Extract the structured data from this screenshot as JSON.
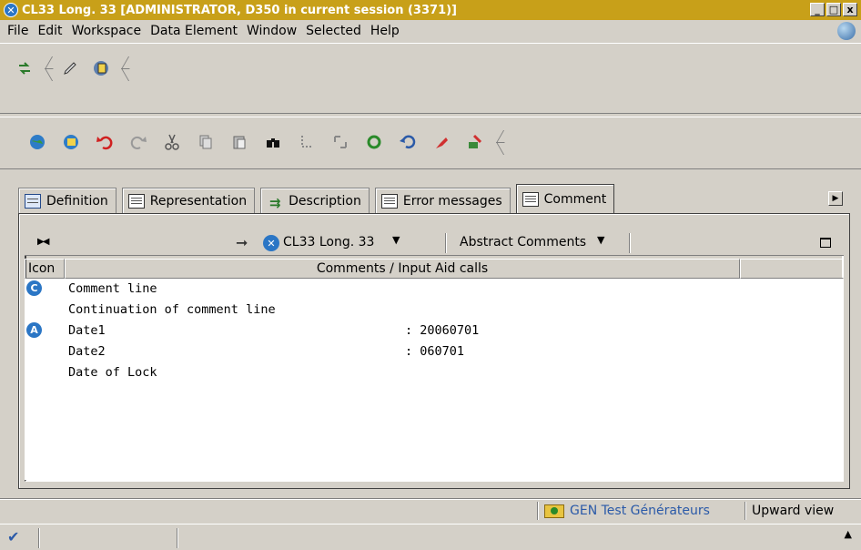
{
  "window": {
    "title": "CL33 Long. 33 [ADMINISTRATOR, D350 in current session (3371)]",
    "minimize": "_",
    "maximize": "□",
    "close": "x"
  },
  "menu": [
    "File",
    "Edit",
    "Workspace",
    "Data Element",
    "Window",
    "Selected",
    "Help"
  ],
  "toolbar1": {
    "icons": [
      "swap-icon",
      "pen-icon",
      "info-book-icon"
    ]
  },
  "toolbar2": {
    "icons": [
      "globe-icon",
      "list-icon",
      "undo-icon",
      "redo-icon",
      "cut-icon",
      "copy-icon",
      "paste-icon",
      "find-icon",
      "select-icon",
      "expand-icon",
      "refresh-icon",
      "back-icon",
      "pin-icon",
      "tools-icon"
    ]
  },
  "tabs": [
    {
      "label": "Definition",
      "icon": "edit-icon"
    },
    {
      "label": "Representation",
      "icon": "form-icon"
    },
    {
      "label": "Description",
      "icon": "description-icon"
    },
    {
      "label": "Error messages",
      "icon": "form-icon"
    },
    {
      "label": "Comment",
      "icon": "form-icon",
      "active": true
    }
  ],
  "panel": {
    "object_name": "CL33 Long. 33",
    "view_name": "Abstract Comments"
  },
  "columns": {
    "icon": "Icon",
    "comments": "Comments / Input Aid calls"
  },
  "rows": [
    {
      "badge": "C",
      "text": "Comment line",
      "value": ""
    },
    {
      "badge": "",
      "text": "Continuation of comment line",
      "value": ""
    },
    {
      "badge": "A",
      "text": "Date1",
      "value": ": 20060701"
    },
    {
      "badge": "",
      "text": "Date2",
      "value": ": 060701"
    },
    {
      "badge": "",
      "text": "Date of Lock",
      "value": ""
    }
  ],
  "status": {
    "generator": "GEN Test Générateurs",
    "view": "Upward view"
  },
  "bottom": {
    "check": "✔",
    "caret": "▲"
  },
  "colors": {
    "titlebar": "#c8a019",
    "badge": "#2b76c5"
  }
}
